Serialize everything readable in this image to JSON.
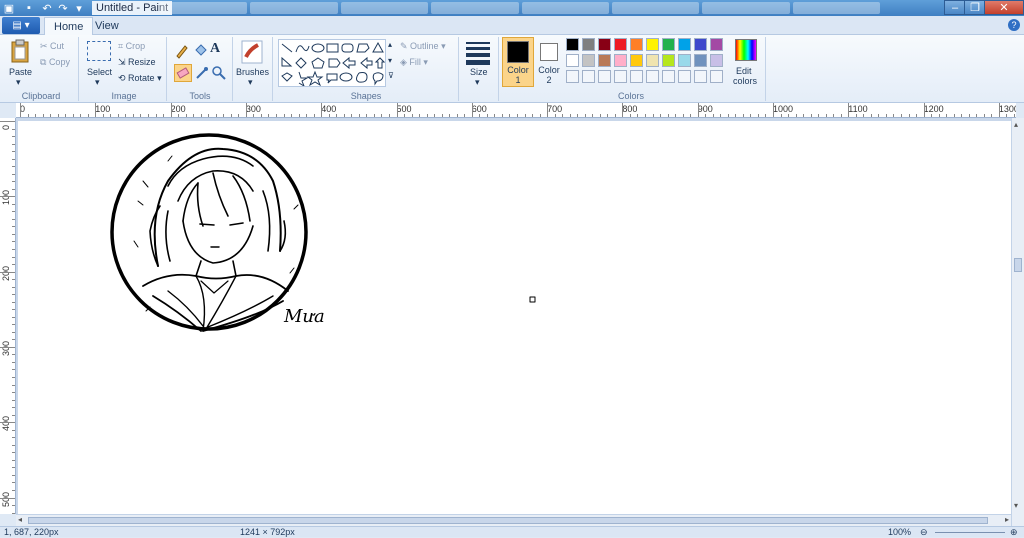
{
  "window": {
    "title": "Untitled - Paint"
  },
  "tabs": {
    "home": "Home",
    "view": "View"
  },
  "ribbon": {
    "clipboard": {
      "paste": "Paste",
      "cut": "Cut",
      "copy": "Copy",
      "label": "Clipboard"
    },
    "image": {
      "select": "Select",
      "crop": "Crop",
      "resize": "Resize",
      "rotate": "Rotate",
      "label": "Image"
    },
    "tools": {
      "label": "Tools"
    },
    "brushes": {
      "label": "Brushes"
    },
    "shapes": {
      "outline": "Outline",
      "fill": "Fill",
      "label": "Shapes"
    },
    "size": {
      "label": "Size"
    },
    "color1": {
      "label": "Color",
      "num": "1",
      "value": "#000000"
    },
    "color2": {
      "label": "Color",
      "num": "2",
      "value": "#ffffff"
    },
    "colors": {
      "label": "Colors",
      "edit": "Edit",
      "edit2": "colors",
      "palette_row1": [
        "#000000",
        "#7f7f7f",
        "#880015",
        "#ed1c24",
        "#ff7f27",
        "#fff200",
        "#22b14c",
        "#00a2e8",
        "#3f48cc",
        "#a349a4"
      ],
      "palette_row2": [
        "#ffffff",
        "#c3c3c3",
        "#b97a57",
        "#ffaec9",
        "#ffc90e",
        "#efe4b0",
        "#b5e61d",
        "#99d9ea",
        "#7092be",
        "#c8bfe7"
      ]
    }
  },
  "ruler": {
    "h_labels": [
      "0",
      "100",
      "200",
      "300",
      "400",
      "500",
      "600",
      "700",
      "800",
      "900",
      "1000",
      "1100",
      "1200",
      "1300"
    ],
    "v_labels": [
      "0",
      "100",
      "200",
      "300",
      "400",
      "500"
    ]
  },
  "drawing": {
    "signature": "Mưa"
  },
  "status": {
    "cursor": "1, 687, 220px",
    "size": "1241 × 792px",
    "zoom": "100%"
  }
}
